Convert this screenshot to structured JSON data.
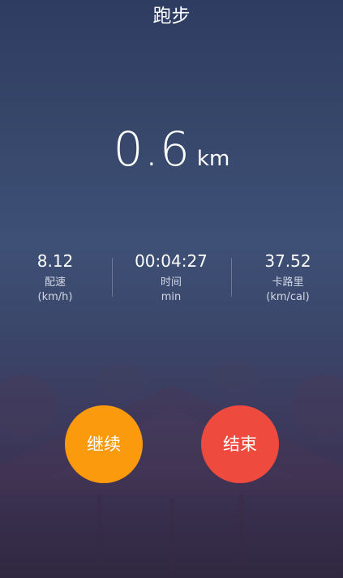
{
  "header": {
    "title": "跑步"
  },
  "distance": {
    "value": "0.6",
    "unit": "km"
  },
  "stats": [
    {
      "value": "8.12",
      "label": "配速",
      "unit": "(km/h)"
    },
    {
      "value": "00:04:27",
      "label": "时间",
      "unit": "min"
    },
    {
      "value": "37.52",
      "label": "卡路里",
      "unit": "(km/cal)"
    }
  ],
  "buttons": {
    "continue_label": "继续",
    "end_label": "结束"
  },
  "colors": {
    "continue_button": "#fb9a0d",
    "end_button": "#ef4a3e",
    "background_top": "#2f3c62",
    "background_bottom": "#302841"
  }
}
